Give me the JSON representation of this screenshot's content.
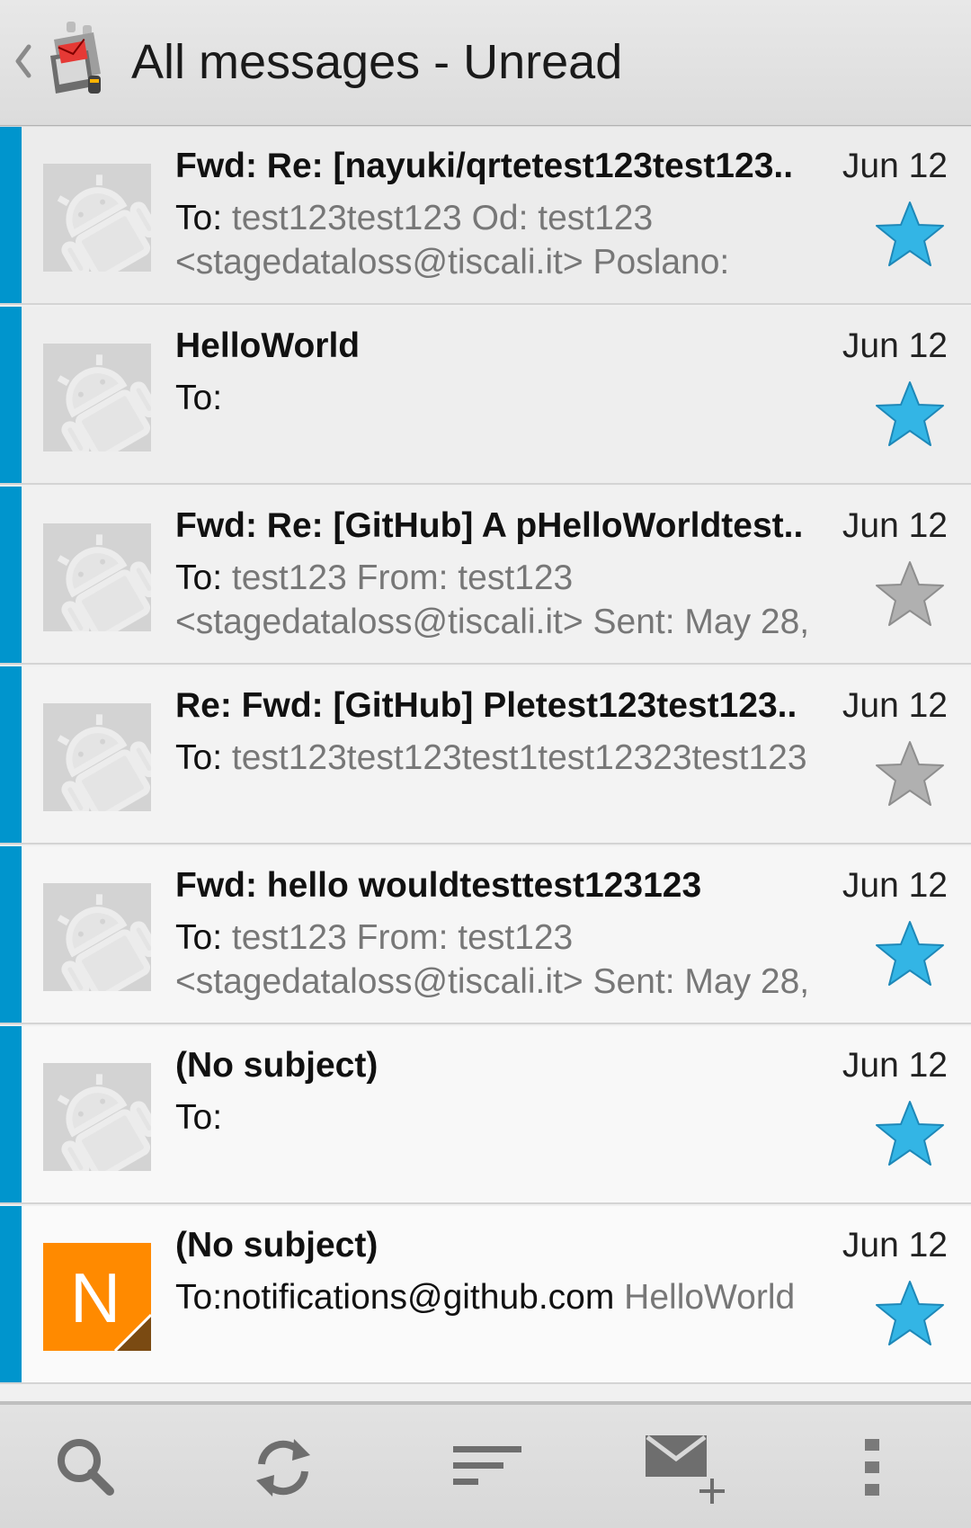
{
  "action_bar": {
    "title": "All messages - Unread"
  },
  "colors": {
    "accent_bar": "#0095cd",
    "star_on": "#33b5e5",
    "star_off": "#b0b0b0",
    "avatar_orange": "#ff8a00"
  },
  "messages": [
    {
      "subject": "Fwd: Re: [nayuki/qrtetest123test123..",
      "date": "Jun 12",
      "to_label": "To:",
      "preview": " test123test123 Od: test123 <stagedataloss@tiscali.it> Poslano:",
      "avatar": "android-placeholder-icon",
      "starred": true
    },
    {
      "subject": "HelloWorld",
      "date": "Jun 12",
      "to_label": "To:",
      "preview": "",
      "avatar": "android-placeholder-icon",
      "starred": true
    },
    {
      "subject": "Fwd: Re: [GitHub] A pHelloWorldtest..",
      "date": "Jun 12",
      "to_label": "To:",
      "preview": " test123 From: test123 <stagedataloss@tiscali.it> Sent: May 28,",
      "avatar": "android-placeholder-icon",
      "starred": false
    },
    {
      "subject": "Re: Fwd: [GitHub] Pletest123test123..",
      "date": "Jun 12",
      "to_label": "To:",
      "preview": " test123test123test1test12323test123",
      "avatar": "android-placeholder-icon",
      "starred": false
    },
    {
      "subject": "Fwd: hello wouldtesttest123123",
      "date": "Jun 12",
      "to_label": "To:",
      "preview": " test123 From: test123 <stagedataloss@tiscali.it> Sent: May 28,",
      "avatar": "android-placeholder-icon",
      "starred": true
    },
    {
      "subject": "(No subject)",
      "date": "Jun 12",
      "to_label": "To:",
      "preview": "",
      "avatar": "android-placeholder-icon",
      "starred": true
    },
    {
      "subject": "(No subject)",
      "date": "Jun 12",
      "to_label": "To:notifications@github.com",
      "preview": " HelloWorld",
      "avatar": "letter",
      "avatar_letter": "N",
      "starred": true
    }
  ],
  "toolbar": {
    "buttons": [
      "search-icon",
      "refresh-icon",
      "sort-icon",
      "compose-icon",
      "overflow-menu-icon"
    ]
  }
}
